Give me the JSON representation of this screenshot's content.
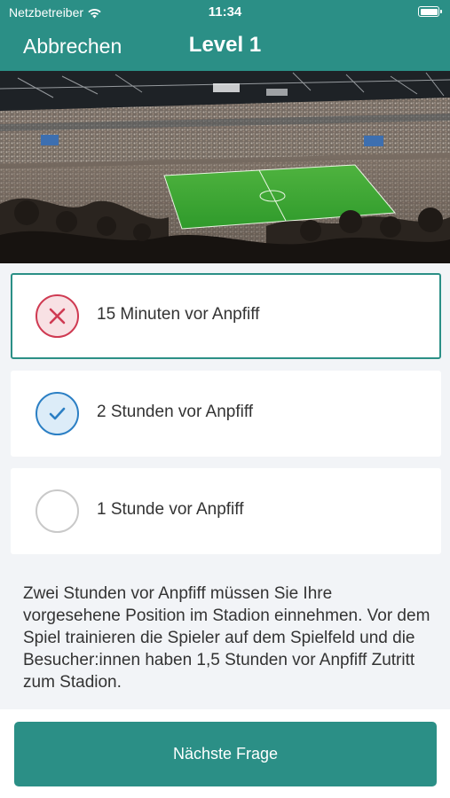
{
  "status_bar": {
    "carrier": "Netzbetreiber",
    "time": "11:34"
  },
  "nav": {
    "cancel_label": "Abbrechen",
    "title": "Level 1"
  },
  "options": [
    {
      "label": "15 Minuten vor Anpfiff",
      "state": "wrong",
      "icon": "x-icon"
    },
    {
      "label": "2 Stunden vor Anpfiff",
      "state": "correct",
      "icon": "check-icon"
    },
    {
      "label": "1 Stunde vor Anpfiff",
      "state": "unselected",
      "icon": "empty-radio"
    }
  ],
  "explanation": "Zwei Stunden vor Anpfiff müssen Sie Ihre vorgesehene Position im Stadion einnehmen. Vor dem Spiel trainieren die Spieler auf dem Spielfeld und die Besucher:innen haben 1,5 Stunden vor Anpfiff Zutritt zum Stadion.",
  "next_button_label": "Nächste Frage",
  "colors": {
    "primary": "#2b8f86",
    "wrong": "#cf3a52",
    "correct": "#2b7fc4",
    "background": "#f2f4f7"
  }
}
